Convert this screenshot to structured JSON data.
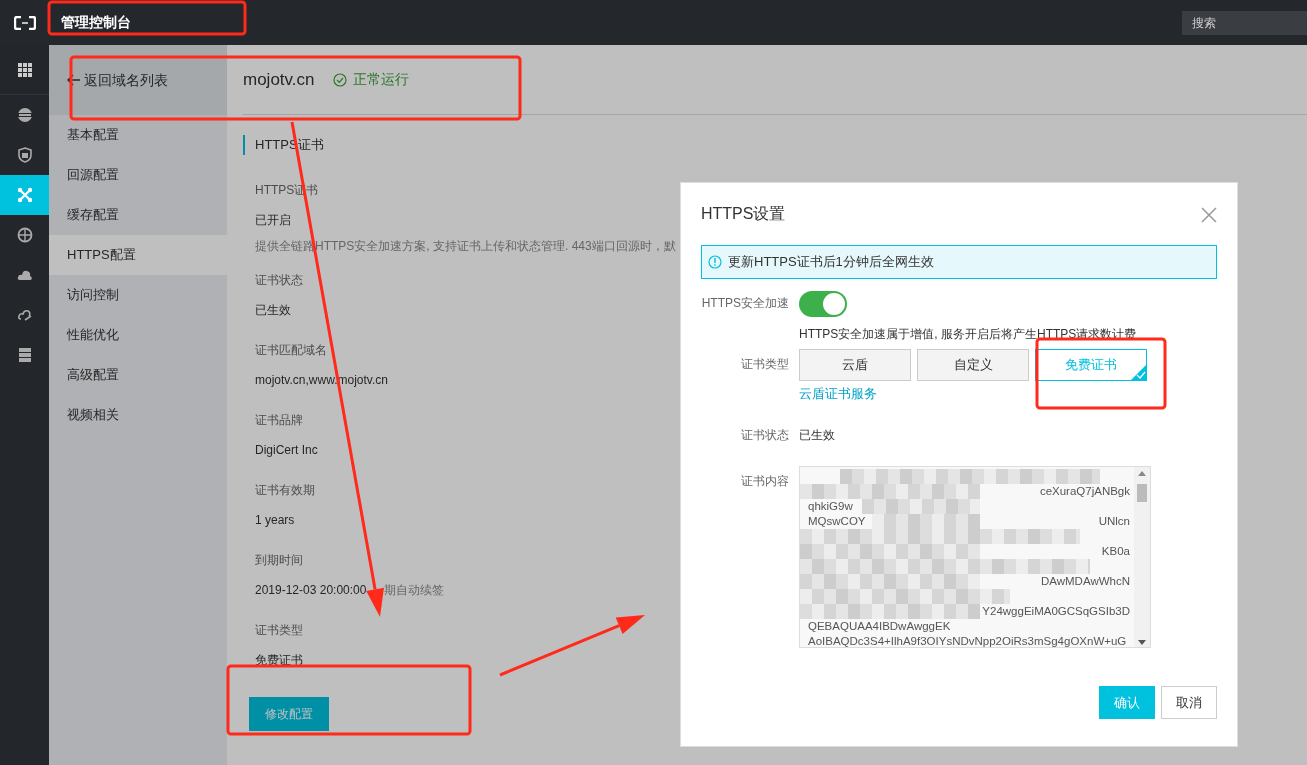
{
  "topbar": {
    "title": "管理控制台",
    "search": {
      "placeholder": "搜索"
    }
  },
  "icon_rail": [
    {
      "kind": "grid",
      "selected": false
    },
    {
      "kind": "dns",
      "selected": false
    },
    {
      "kind": "shield",
      "selected": false
    },
    {
      "kind": "network",
      "selected": true
    },
    {
      "kind": "globe",
      "selected": false
    },
    {
      "kind": "cloud",
      "selected": false
    },
    {
      "kind": "cloud-arrow",
      "selected": false
    },
    {
      "kind": "server",
      "selected": false
    }
  ],
  "nav": {
    "back": "返回域名列表",
    "items": [
      {
        "label": "基本配置",
        "selected": false
      },
      {
        "label": "回源配置",
        "selected": false
      },
      {
        "label": "缓存配置",
        "selected": false
      },
      {
        "label": "HTTPS配置",
        "selected": true
      },
      {
        "label": "访问控制",
        "selected": false
      },
      {
        "label": "性能优化",
        "selected": false
      },
      {
        "label": "高级配置",
        "selected": false
      },
      {
        "label": "视频相关",
        "selected": false
      }
    ]
  },
  "header": {
    "domain": "mojotv.cn",
    "status": "正常运行"
  },
  "section": {
    "title": "HTTPS证书",
    "fields": [
      {
        "label": "HTTPS证书",
        "value": "已开启",
        "note": "提供全链路HTTPS安全加速方案, 支持证书上传和状态管理. 443端口回源时，默"
      },
      {
        "label": "证书状态",
        "value": "已生效"
      },
      {
        "label": "证书匹配域名",
        "value": "mojotv.cn,www.mojotv.cn"
      },
      {
        "label": "证书品牌",
        "value": "DigiCert Inc"
      },
      {
        "label": "证书有效期",
        "value": "1 years"
      },
      {
        "label": "到期时间",
        "value": "2019-12-03 20:00:00",
        "inline_note": "期自动续签"
      },
      {
        "label": "证书类型",
        "value": "免费证书"
      }
    ],
    "edit_button": "修改配置"
  },
  "modal": {
    "title": "HTTPS设置",
    "alert": "更新HTTPS证书后1分钟后全网生效",
    "switch": {
      "label": "HTTPS安全加速",
      "on": true,
      "hint": "HTTPS安全加速属于增值, 服务开启后将产生HTTPS请求数计费"
    },
    "cert_type": {
      "label": "证书类型",
      "options": [
        {
          "label": "云盾",
          "selected": false
        },
        {
          "label": "自定义",
          "selected": false
        },
        {
          "label": "免费证书",
          "selected": true
        }
      ],
      "link": "云盾证书服务"
    },
    "cert_status": {
      "label": "证书状态",
      "value": "已生效"
    },
    "cert_content": {
      "label": "证书内容",
      "lines": [
        {
          "kind": "redacted"
        },
        {
          "right": "ceXuraQ7jANBgk"
        },
        {
          "left": "qhkiG9w"
        },
        {
          "left": "MQswCOY",
          "right": "UNlcn"
        },
        {
          "kind": "redacted"
        },
        {
          "right": "KB0a"
        },
        {
          "kind": "redacted"
        },
        {
          "right": "DAwMDAwWhcN"
        },
        {
          "kind": "redacted"
        },
        {
          "right": "Y24wggEiMA0GCSqGSIb3D"
        },
        {
          "left": "QEBAQUAA4IBDwAwggEK"
        },
        {
          "left": "AoIBAQDc3S4+IlhA9f3OIYsNDvNpp2OiRs3mSg4gOXnW+uG"
        }
      ]
    },
    "buttons": [
      {
        "label": "确认",
        "kind": "primary"
      },
      {
        "label": "取消",
        "kind": "default"
      }
    ]
  }
}
